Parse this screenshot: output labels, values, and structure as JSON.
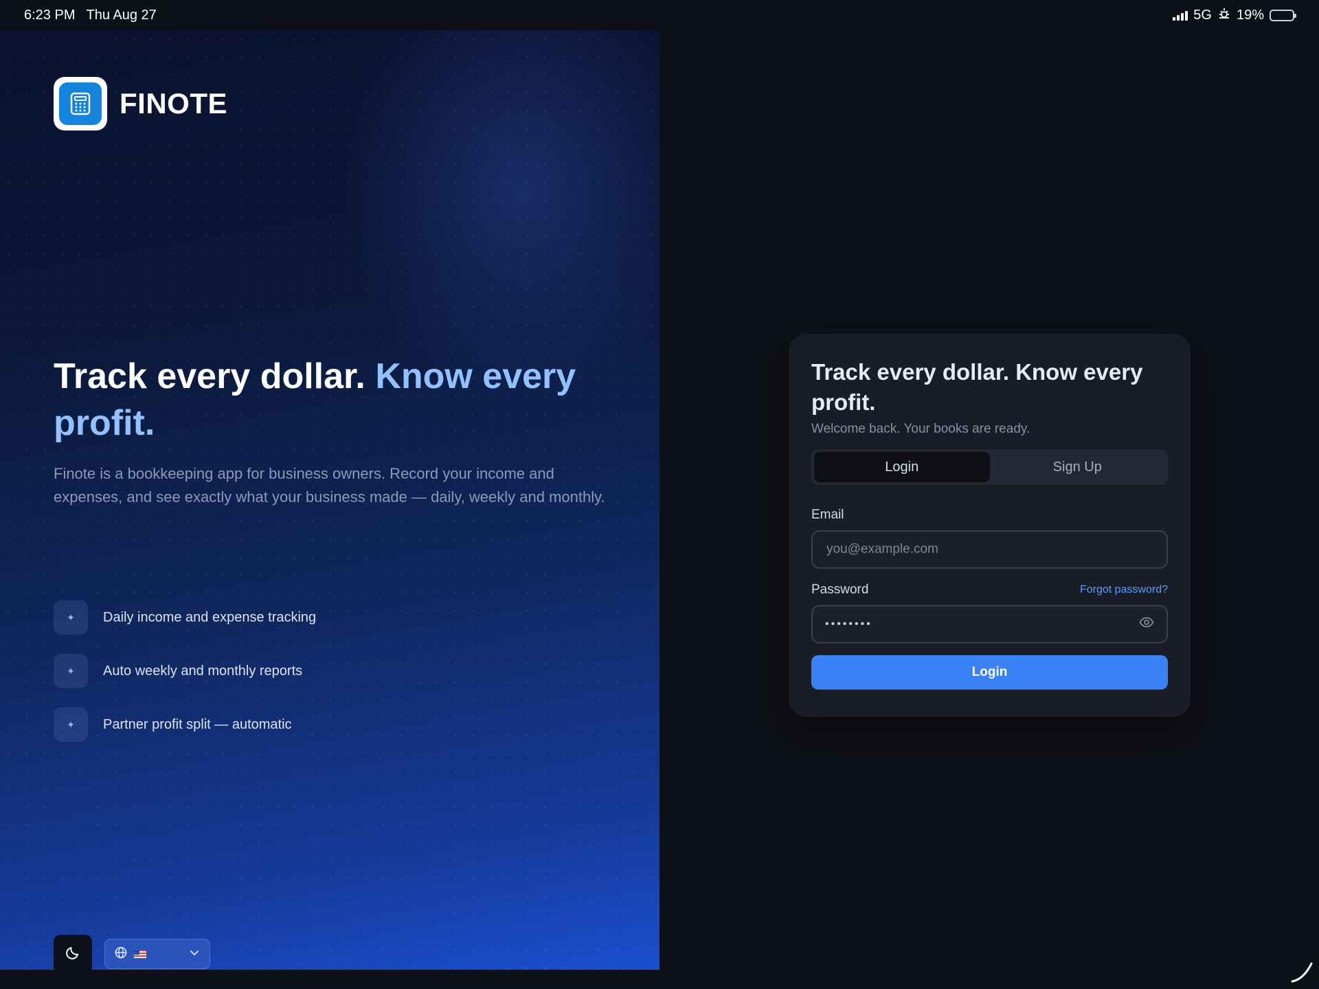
{
  "status_bar": {
    "time": "6:23 PM",
    "date": "Thu Aug 27",
    "network": "5G",
    "battery": "19%",
    "battery_level": 0.19
  },
  "brand": {
    "name": "FINOTE",
    "logo_icon": "calculator-icon",
    "logo_colors": {
      "tile": "#ffffff",
      "inner": "#1483dc"
    }
  },
  "hero": {
    "headline_main": "Track every dollar.",
    "headline_accent": "Know every profit.",
    "description": "Finote is a bookkeeping app for business owners. Record your income and expenses, and see exactly what your business made — daily, weekly and monthly.",
    "features": [
      {
        "icon": "sparkle-icon",
        "text": "Daily income and expense tracking"
      },
      {
        "icon": "sparkle-icon",
        "text": "Auto weekly and monthly reports"
      },
      {
        "icon": "sparkle-icon",
        "text": "Partner profit split — automatic"
      }
    ],
    "theme_toggle_icon": "moon-icon",
    "language": {
      "globe_icon": "globe-icon",
      "flag": "us-flag-icon",
      "chevron": "chevron-down-icon"
    }
  },
  "login_card": {
    "title": "Track every dollar. Know every profit.",
    "subtitle": "Welcome back. Your books are ready.",
    "tabs": [
      {
        "label": "Login",
        "active": true
      },
      {
        "label": "Sign Up",
        "active": false
      }
    ],
    "email": {
      "label": "Email",
      "placeholder": "you@example.com",
      "value": ""
    },
    "password": {
      "label": "Password",
      "masked_value": "••••••••",
      "forgot_label": "Forgot password?",
      "toggle_icon": "eye-icon"
    },
    "submit_label": "Login"
  },
  "colors": {
    "accent": "#3b82f6",
    "headline_accent": "#93c0ff",
    "link": "#5b9dff",
    "card_bg": "#1a1d27",
    "page_bg": "#0f1118"
  }
}
